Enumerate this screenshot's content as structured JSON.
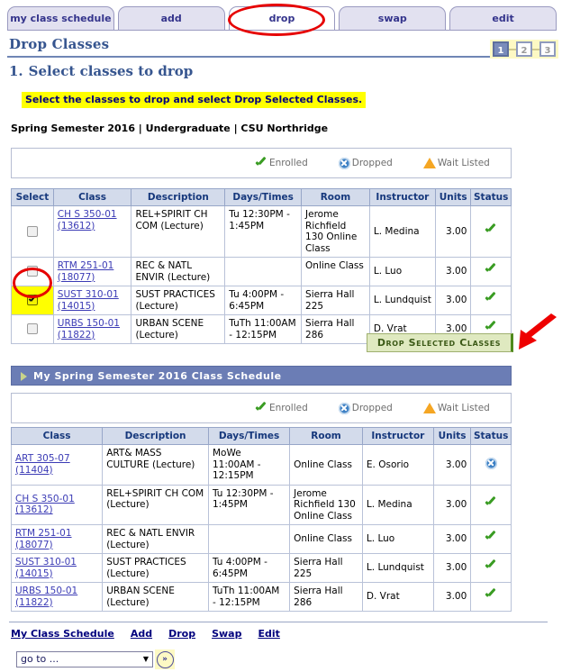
{
  "tabs": [
    {
      "label": "my class schedule",
      "active": false
    },
    {
      "label": "add",
      "active": false
    },
    {
      "label": "drop",
      "active": true
    },
    {
      "label": "swap",
      "active": false
    },
    {
      "label": "edit",
      "active": false
    }
  ],
  "page": {
    "title": "Drop Classes",
    "step_number": "1.",
    "step_heading": "Select classes to drop",
    "instruction": "Select the classes to drop and select Drop Selected Classes.",
    "term_line": "Spring Semester 2016 | Undergraduate | CSU Northridge"
  },
  "steps": [
    {
      "label": "1",
      "active": true
    },
    {
      "label": "2",
      "active": false
    },
    {
      "label": "3",
      "active": false
    }
  ],
  "legend": [
    {
      "icon": "green-check-icon",
      "label": "Enrolled"
    },
    {
      "icon": "blue-circle-x-icon",
      "label": "Dropped"
    },
    {
      "icon": "orange-triangle-icon",
      "label": "Wait Listed"
    }
  ],
  "select_table": {
    "headers": [
      "Select",
      "Class",
      "Description",
      "Days/Times",
      "Room",
      "Instructor",
      "Units",
      "Status"
    ],
    "rows": [
      {
        "selected": false,
        "class_name": "CH S 350-01",
        "class_nbr": "(13612)",
        "description": "REL+SPIRIT CH COM (Lecture)",
        "days_times": "Tu 12:30PM - 1:45PM",
        "room": "Jerome Richfield 130 Online Class",
        "instructor": "L. Medina",
        "units": "3.00",
        "status": "enrolled"
      },
      {
        "selected": false,
        "class_name": "RTM 251-01",
        "class_nbr": "(18077)",
        "description": "REC & NATL ENVIR (Lecture)",
        "days_times": "",
        "room": "Online Class",
        "instructor": "L. Luo",
        "units": "3.00",
        "status": "enrolled"
      },
      {
        "selected": true,
        "class_name": "SUST 310-01",
        "class_nbr": "(14015)",
        "description": "SUST PRACTICES (Lecture)",
        "days_times": "Tu 4:00PM - 6:45PM",
        "room": "Sierra Hall 225",
        "instructor": "L. Lundquist",
        "units": "3.00",
        "status": "enrolled"
      },
      {
        "selected": false,
        "class_name": "URBS 150-01",
        "class_nbr": "(11822)",
        "description": "URBAN SCENE (Lecture)",
        "days_times": "TuTh 11:00AM - 12:15PM",
        "room": "Sierra Hall 286",
        "instructor": "D. Vrat",
        "units": "3.00",
        "status": "enrolled"
      }
    ]
  },
  "drop_button": {
    "label": "Drop Selected Classes"
  },
  "schedule_section": {
    "title": "My Spring Semester 2016 Class Schedule",
    "headers": [
      "Class",
      "Description",
      "Days/Times",
      "Room",
      "Instructor",
      "Units",
      "Status"
    ],
    "rows": [
      {
        "class_name": "ART 305-07",
        "class_nbr": "(11404)",
        "description": "ART& MASS CULTURE (Lecture)",
        "days_times": "MoWe 11:00AM - 12:15PM",
        "room": "Online Class",
        "instructor": "E. Osorio",
        "units": "3.00",
        "status": "dropped"
      },
      {
        "class_name": "CH S 350-01",
        "class_nbr": "(13612)",
        "description": "REL+SPIRIT CH COM (Lecture)",
        "days_times": "Tu 12:30PM - 1:45PM",
        "room": "Jerome Richfield 130 Online Class",
        "instructor": "L. Medina",
        "units": "3.00",
        "status": "enrolled"
      },
      {
        "class_name": "RTM 251-01",
        "class_nbr": "(18077)",
        "description": "REC & NATL ENVIR (Lecture)",
        "days_times": "",
        "room": "Online Class",
        "instructor": "L. Luo",
        "units": "3.00",
        "status": "enrolled"
      },
      {
        "class_name": "SUST 310-01",
        "class_nbr": "(14015)",
        "description": "SUST PRACTICES (Lecture)",
        "days_times": "Tu 4:00PM - 6:45PM",
        "room": "Sierra Hall 225",
        "instructor": "L. Lundquist",
        "units": "3.00",
        "status": "enrolled"
      },
      {
        "class_name": "URBS 150-01",
        "class_nbr": "(11822)",
        "description": "URBAN SCENE (Lecture)",
        "days_times": "TuTh 11:00AM - 12:15PM",
        "room": "Sierra Hall 286",
        "instructor": "D. Vrat",
        "units": "3.00",
        "status": "enrolled"
      }
    ]
  },
  "footer": {
    "links": [
      "My Class Schedule",
      "Add",
      "Drop",
      "Swap",
      "Edit"
    ],
    "goto_value": "go to ...",
    "go_icon": "»"
  },
  "colors": {
    "accent": "#36558f",
    "tab_inactive": "#e2e1f0",
    "header": "#d3dbeb",
    "section_bar": "#6b7db5",
    "highlight": "#ffff00",
    "annotation": "#e60000",
    "enrolled": "#3a9c23",
    "dropped": "#3b7fc4",
    "waitlisted": "#f5a623"
  }
}
